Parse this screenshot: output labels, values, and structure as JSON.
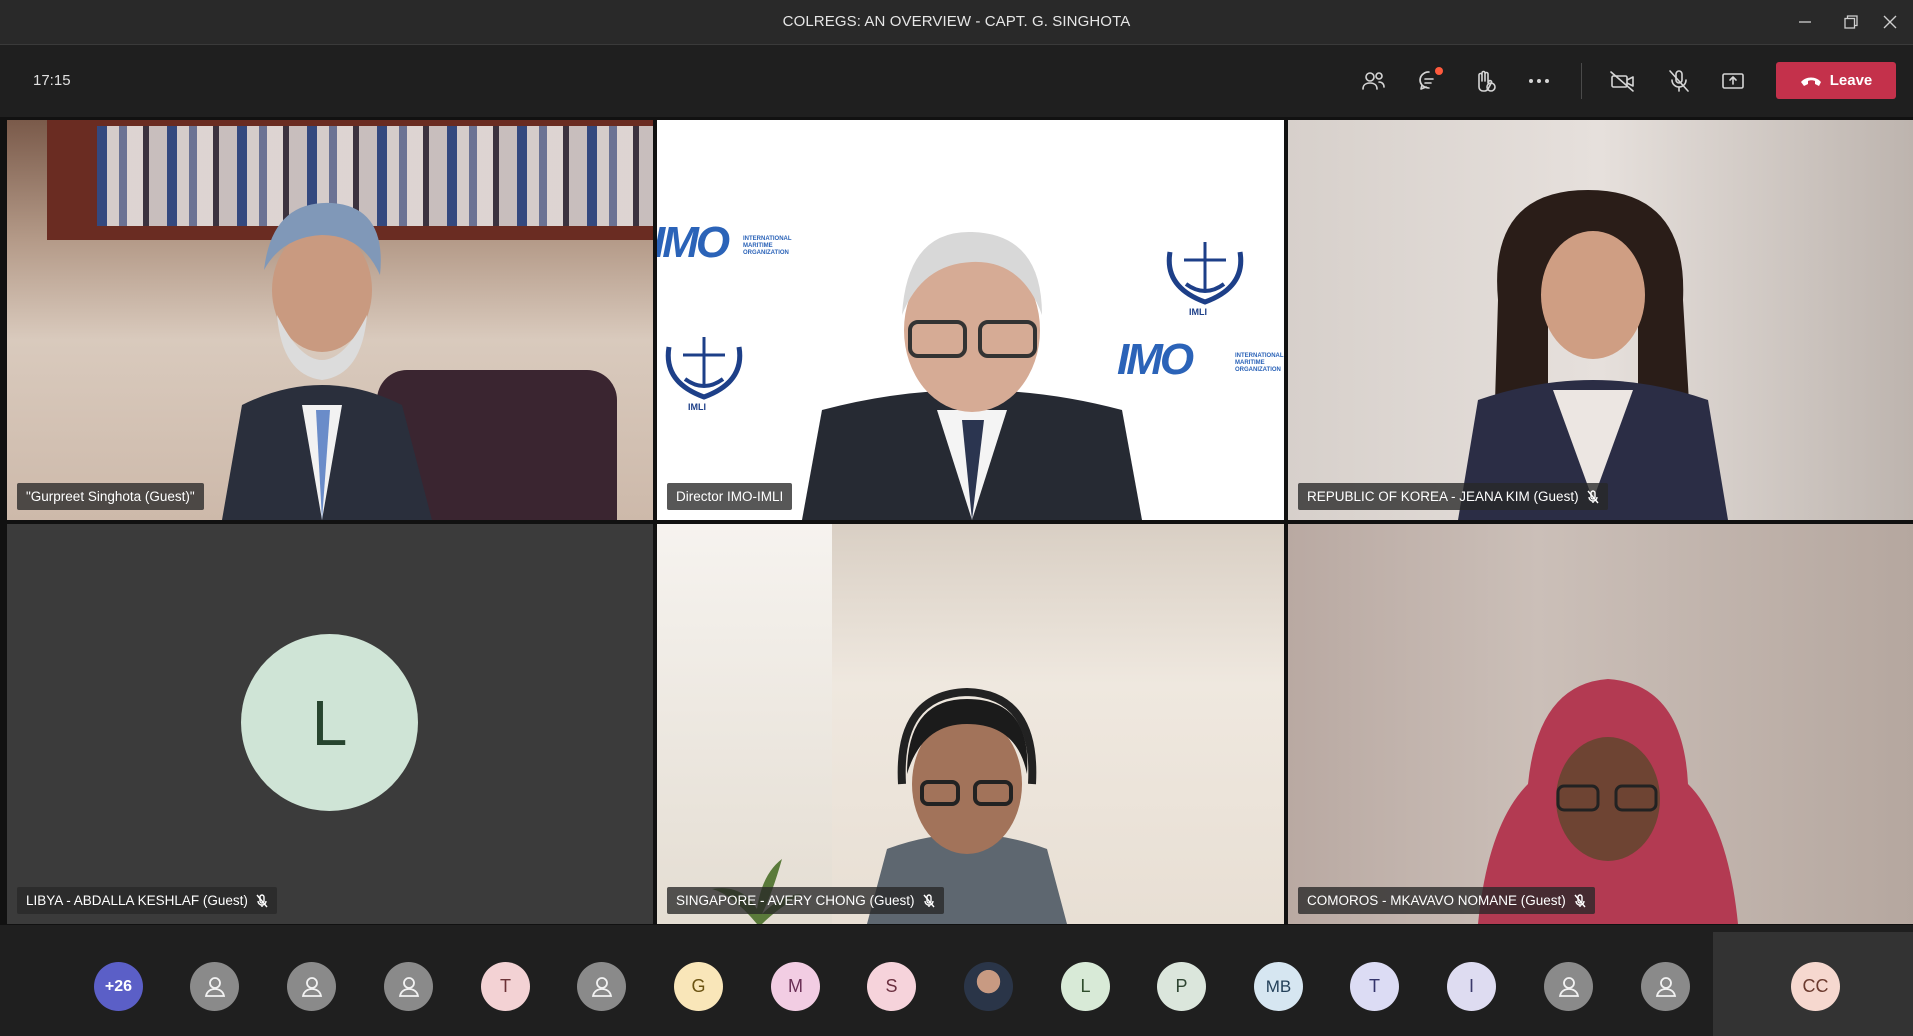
{
  "window": {
    "title": "COLREGS: AN OVERVIEW - CAPT. G. SINGHOTA"
  },
  "toolbar": {
    "time": "17:15",
    "leave_label": "Leave"
  },
  "tiles": [
    {
      "name": "\"Gurpreet Singhota (Guest)\"",
      "muted": false
    },
    {
      "name": "Director IMO-IMLI",
      "muted": false
    },
    {
      "name": "REPUBLIC OF KOREA - JEANA KIM (Guest)",
      "muted": true
    },
    {
      "name": "LIBYA - ABDALLA KESHLAF (Guest)",
      "muted": true,
      "avatar": "L"
    },
    {
      "name": "SINGAPORE - AVERY CHONG (Guest)",
      "muted": true
    },
    {
      "name": "COMOROS - MKAVAVO NOMANE (Guest)",
      "muted": true
    }
  ],
  "backdrop": {
    "org_line1": "INTERNATIONAL",
    "org_line2": "MARITIME",
    "org_line3": "ORGANIZATION",
    "imo": "IMO",
    "imli": "IMLI"
  },
  "strip": {
    "overflow": "+26",
    "initials": [
      "T",
      "G",
      "M",
      "S",
      "L",
      "P",
      "MB",
      "T",
      "I"
    ],
    "self": "CC"
  },
  "colors": {
    "leave": "#c4314b",
    "overflow_avatar": "#5b5fc7"
  }
}
